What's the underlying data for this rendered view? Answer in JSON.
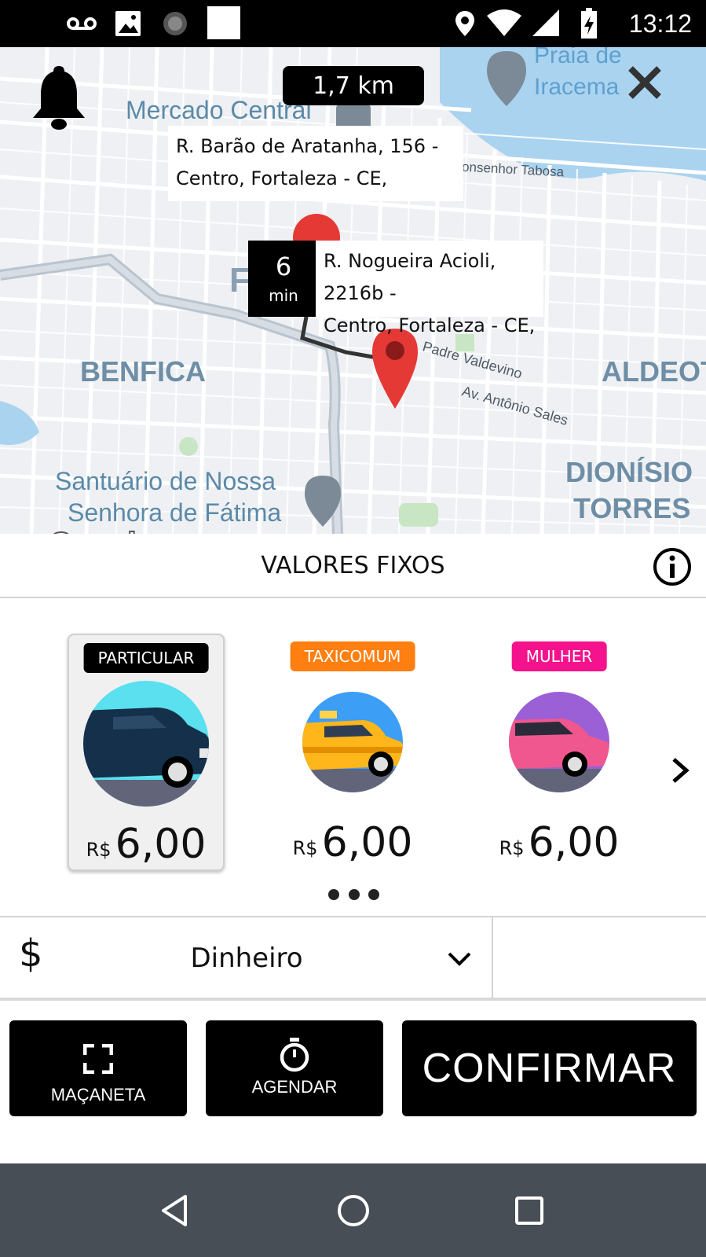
{
  "status_bar": {
    "time": "13:12",
    "icons": [
      "voicemail-icon",
      "image-icon",
      "spinner-icon",
      "blank-square-icon",
      "location-icon",
      "wifi-icon",
      "signal-icon",
      "battery-charging-icon"
    ]
  },
  "map": {
    "distance": "1,7 km",
    "origin_address_line1": "R. Barão de Aratanha, 156 -",
    "origin_address_line2": "Centro, Fortaleza - CE,",
    "eta_value": "6",
    "eta_unit": "min",
    "destination_address_line1": "R. Nogueira Acioli, 2216b -",
    "destination_address_line2": "Centro, Fortaleza - CE,",
    "labels": {
      "mercado_central": "Mercado Central",
      "praia_line1": "Praia de",
      "praia_line2": "Iracema",
      "monsenhor_tabosa": "onsenhor Tabosa",
      "benfica": "BENFICA",
      "aldeota": "ALDEOT",
      "padre_valdevino": "Padre Valdevino",
      "antonio_sales": "Av. Antônio Sales",
      "santuario_line1": "Santuário de Nossa",
      "santuario_line2": "Senhora de Fátima",
      "dionisio": "DIONÍSIO",
      "torres": "TORRES",
      "f_letter": "F"
    },
    "google": "Google",
    "pin_color": "#e53935"
  },
  "fixed_values": {
    "title": "VALORES FIXOS"
  },
  "cards": [
    {
      "badge": "PARTICULAR",
      "badge_color": "#000000",
      "currency": "R$",
      "price": "6,00",
      "selected": true
    },
    {
      "badge": "TAXICOMUM",
      "badge_color": "#ff7f11",
      "currency": "R$",
      "price": "6,00",
      "selected": false
    },
    {
      "badge": "MULHER",
      "badge_color": "#f5138d",
      "currency": "R$",
      "price": "6,00",
      "selected": false
    }
  ],
  "payment": {
    "symbol": "$",
    "method": "Dinheiro"
  },
  "actions": {
    "handle_label": "MAÇANETA",
    "schedule_label": "AGENDAR",
    "confirm_label": "CONFIRMAR"
  }
}
